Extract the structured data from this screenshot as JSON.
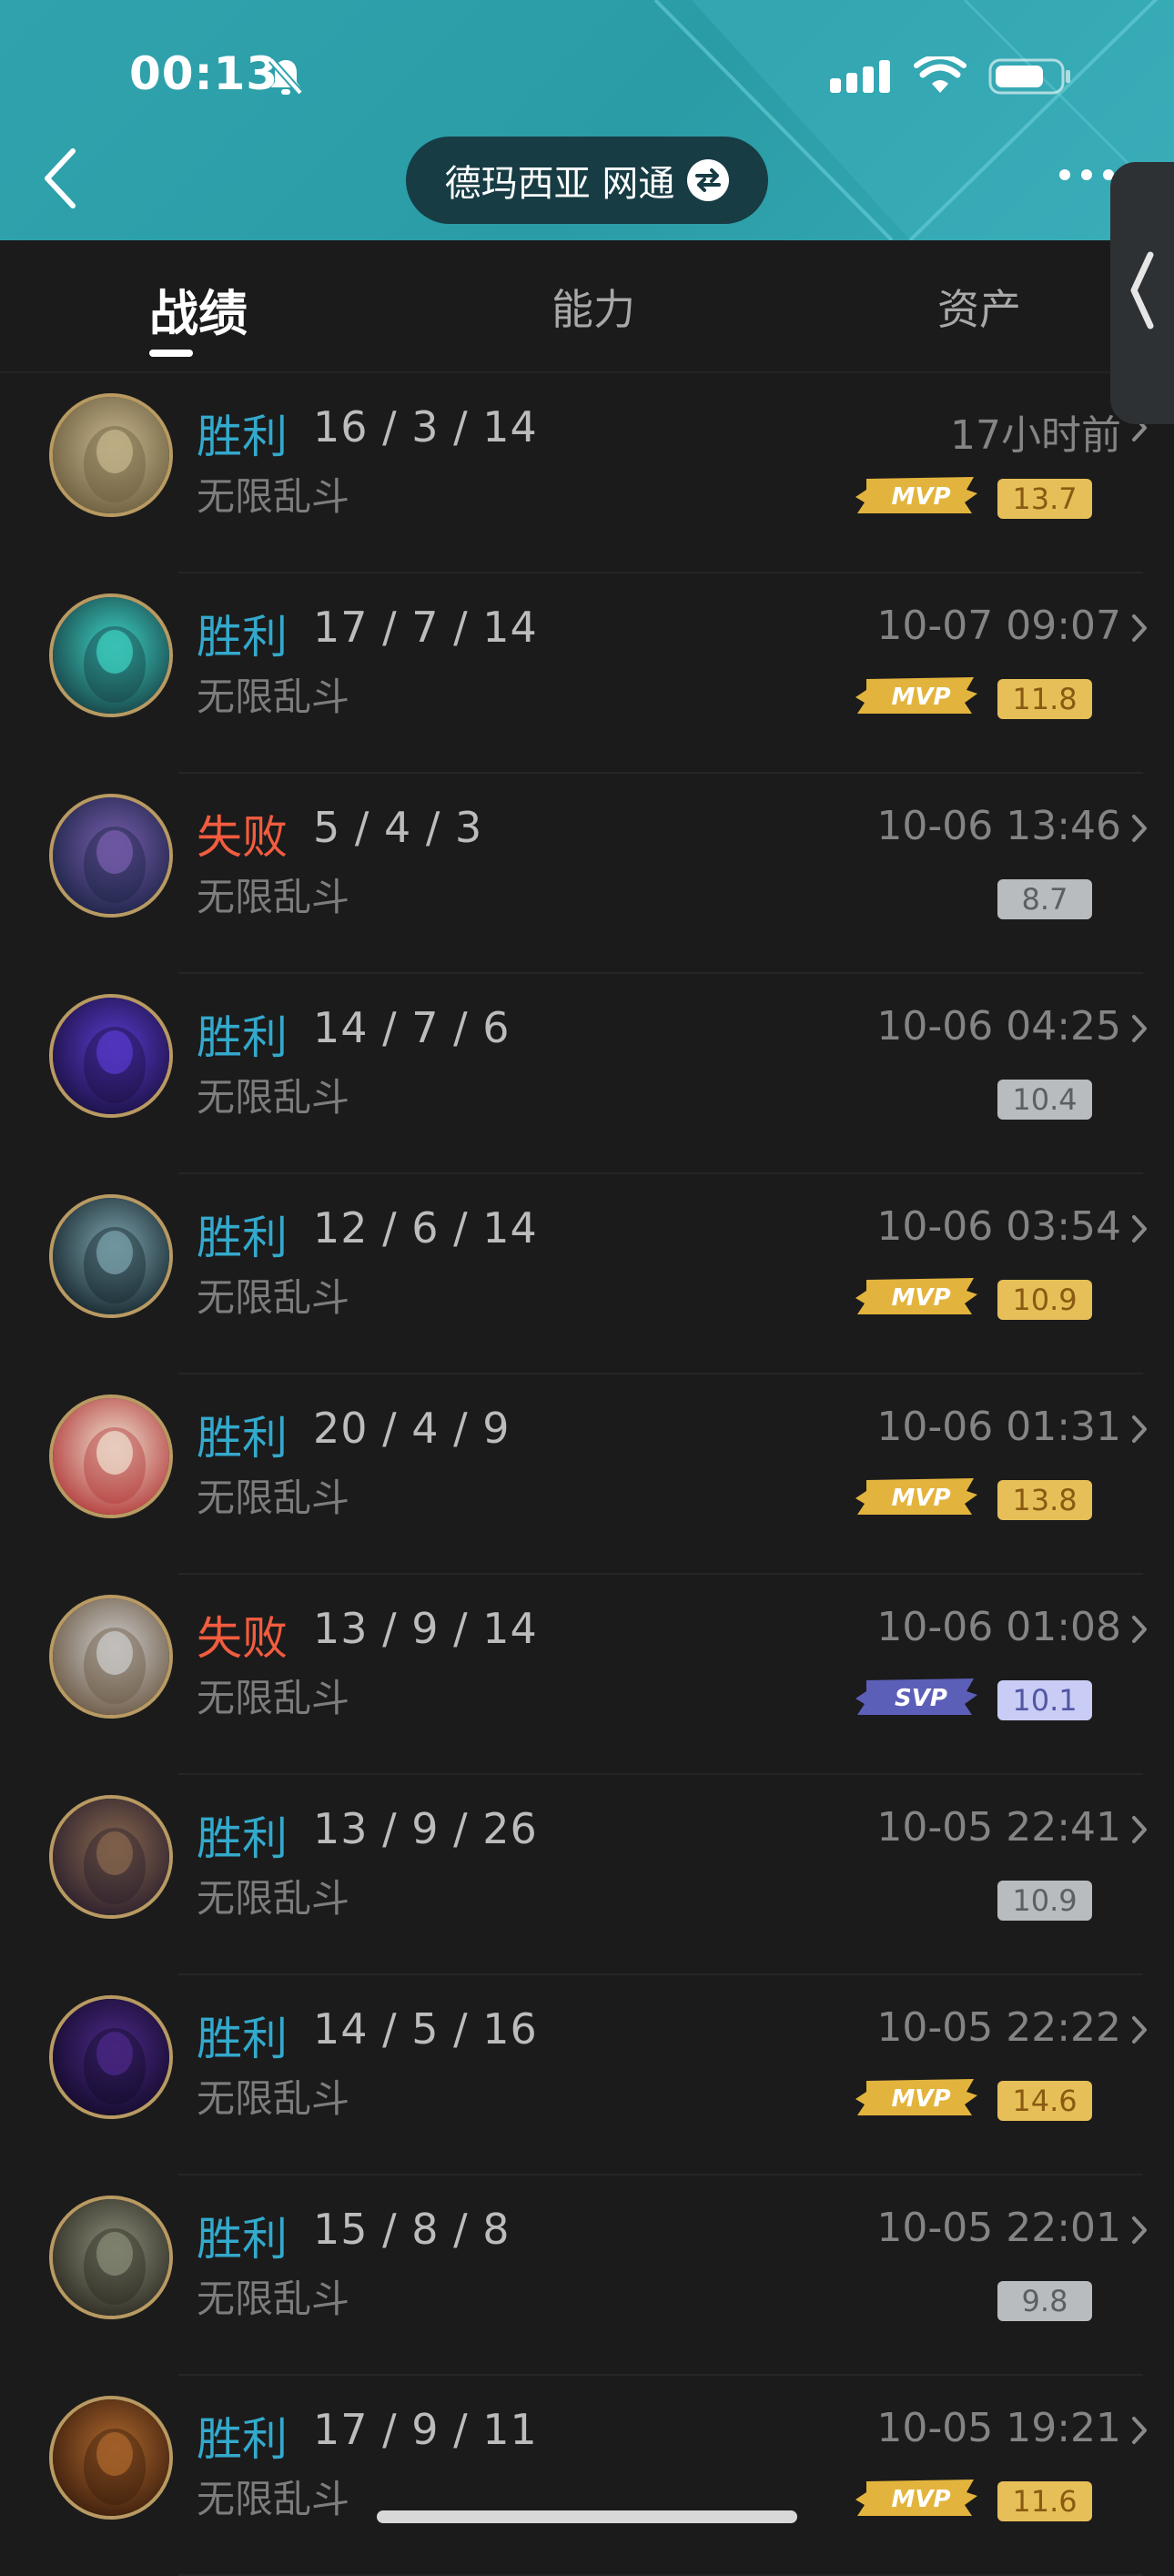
{
  "status_bar": {
    "time": "00:13"
  },
  "header": {
    "server": "德玛西亚 网通"
  },
  "tabs": [
    {
      "label": "战绩",
      "active": true
    },
    {
      "label": "能力",
      "active": false
    },
    {
      "label": "资产",
      "active": false
    }
  ],
  "matches": [
    {
      "result": "胜利",
      "outcome": "win",
      "kda": "16 / 3 / 14",
      "mode": "无限乱斗",
      "time": "17小时前",
      "badge": "MVP",
      "score": "13.7",
      "score_style": "gold",
      "avatar_colors": [
        "#c9b98f",
        "#6b5d3e"
      ]
    },
    {
      "result": "胜利",
      "outcome": "win",
      "kda": "17 / 7 / 14",
      "mode": "无限乱斗",
      "time": "10-07 09:07",
      "badge": "MVP",
      "score": "11.8",
      "score_style": "gold",
      "avatar_colors": [
        "#3ed6c6",
        "#173f44"
      ]
    },
    {
      "result": "失败",
      "outcome": "lose",
      "kda": "5 / 4 / 3",
      "mode": "无限乱斗",
      "time": "10-06 13:46",
      "badge": "",
      "score": "8.7",
      "score_style": "gray",
      "avatar_colors": [
        "#7a5fb0",
        "#1b2345"
      ]
    },
    {
      "result": "胜利",
      "outcome": "win",
      "kda": "14 / 7 / 6",
      "mode": "无限乱斗",
      "time": "10-06 04:25",
      "badge": "",
      "score": "10.4",
      "score_style": "gray",
      "avatar_colors": [
        "#5a3bd0",
        "#1a1040"
      ]
    },
    {
      "result": "胜利",
      "outcome": "win",
      "kda": "12 / 6 / 14",
      "mode": "无限乱斗",
      "time": "10-06 03:54",
      "badge": "MVP",
      "score": "10.9",
      "score_style": "gold",
      "avatar_colors": [
        "#7fa6b0",
        "#15252c"
      ]
    },
    {
      "result": "胜利",
      "outcome": "win",
      "kda": "20 / 4 / 9",
      "mode": "无限乱斗",
      "time": "10-06 01:31",
      "badge": "MVP",
      "score": "13.8",
      "score_style": "gold",
      "avatar_colors": [
        "#efe3d2",
        "#b33a3a"
      ]
    },
    {
      "result": "失败",
      "outcome": "lose",
      "kda": "13 / 9 / 14",
      "mode": "无限乱斗",
      "time": "10-06 01:08",
      "badge": "SVP",
      "score": "10.1",
      "score_style": "purple",
      "avatar_colors": [
        "#cfcfcf",
        "#6b5843"
      ]
    },
    {
      "result": "胜利",
      "outcome": "win",
      "kda": "13 / 9 / 26",
      "mode": "无限乱斗",
      "time": "10-05 22:41",
      "badge": "",
      "score": "10.9",
      "score_style": "gray",
      "avatar_colors": [
        "#8a6a4e",
        "#2a1e2c"
      ]
    },
    {
      "result": "胜利",
      "outcome": "win",
      "kda": "14 / 5 / 16",
      "mode": "无限乱斗",
      "time": "10-05 22:22",
      "badge": "MVP",
      "score": "14.6",
      "score_style": "gold",
      "avatar_colors": [
        "#4d2a8a",
        "#120a28"
      ]
    },
    {
      "result": "胜利",
      "outcome": "win",
      "kda": "15 / 8 / 8",
      "mode": "无限乱斗",
      "time": "10-05 22:01",
      "badge": "",
      "score": "9.8",
      "score_style": "gray",
      "avatar_colors": [
        "#8c8f7a",
        "#2c2a22"
      ]
    },
    {
      "result": "胜利",
      "outcome": "win",
      "kda": "17 / 9 / 11",
      "mode": "无限乱斗",
      "time": "10-05 19:21",
      "badge": "MVP",
      "score": "11.6",
      "score_style": "gold",
      "avatar_colors": [
        "#b06a2e",
        "#3a1c0c"
      ]
    }
  ]
}
